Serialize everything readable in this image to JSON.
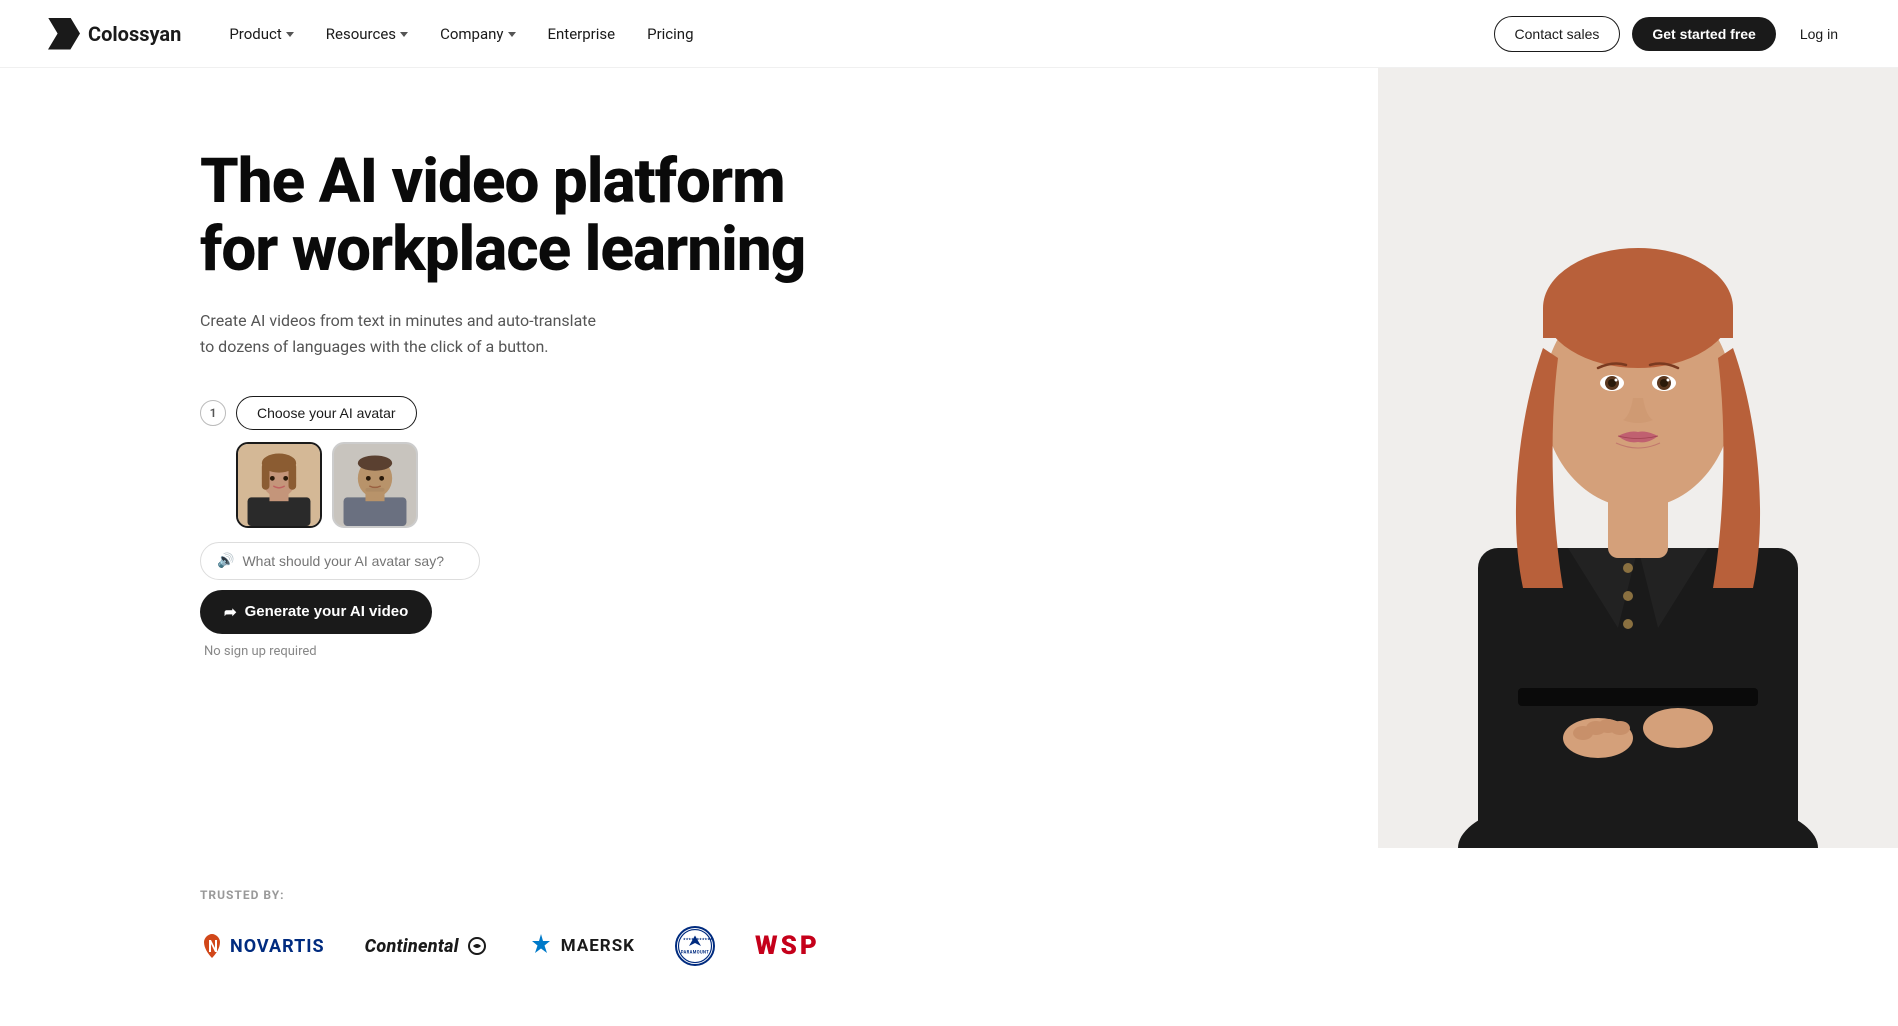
{
  "nav": {
    "logo_text": "Colossyan",
    "links": [
      {
        "label": "Product",
        "has_dropdown": true
      },
      {
        "label": "Resources",
        "has_dropdown": true
      },
      {
        "label": "Company",
        "has_dropdown": true
      },
      {
        "label": "Enterprise",
        "has_dropdown": false
      },
      {
        "label": "Pricing",
        "has_dropdown": false
      }
    ],
    "contact_sales": "Contact sales",
    "get_started": "Get started free",
    "login": "Log in"
  },
  "hero": {
    "title_line1": "The AI video platform",
    "title_line2": "for workplace learning",
    "subtitle": "Create AI videos from text in minutes and auto-translate to dozens of languages with the click of a button.",
    "step_number": "1",
    "choose_avatar_label": "Choose your AI avatar",
    "say_placeholder": "What should your AI avatar say?",
    "generate_label": "Generate your AI video",
    "no_signup": "No sign up required"
  },
  "trusted": {
    "label": "TRUSTED BY:",
    "logos": [
      {
        "name": "Novartis",
        "type": "novartis"
      },
      {
        "name": "Continental",
        "type": "continental"
      },
      {
        "name": "Maersk",
        "type": "maersk"
      },
      {
        "name": "Paramount",
        "type": "paramount"
      },
      {
        "name": "WSP",
        "type": "wsp"
      }
    ]
  }
}
